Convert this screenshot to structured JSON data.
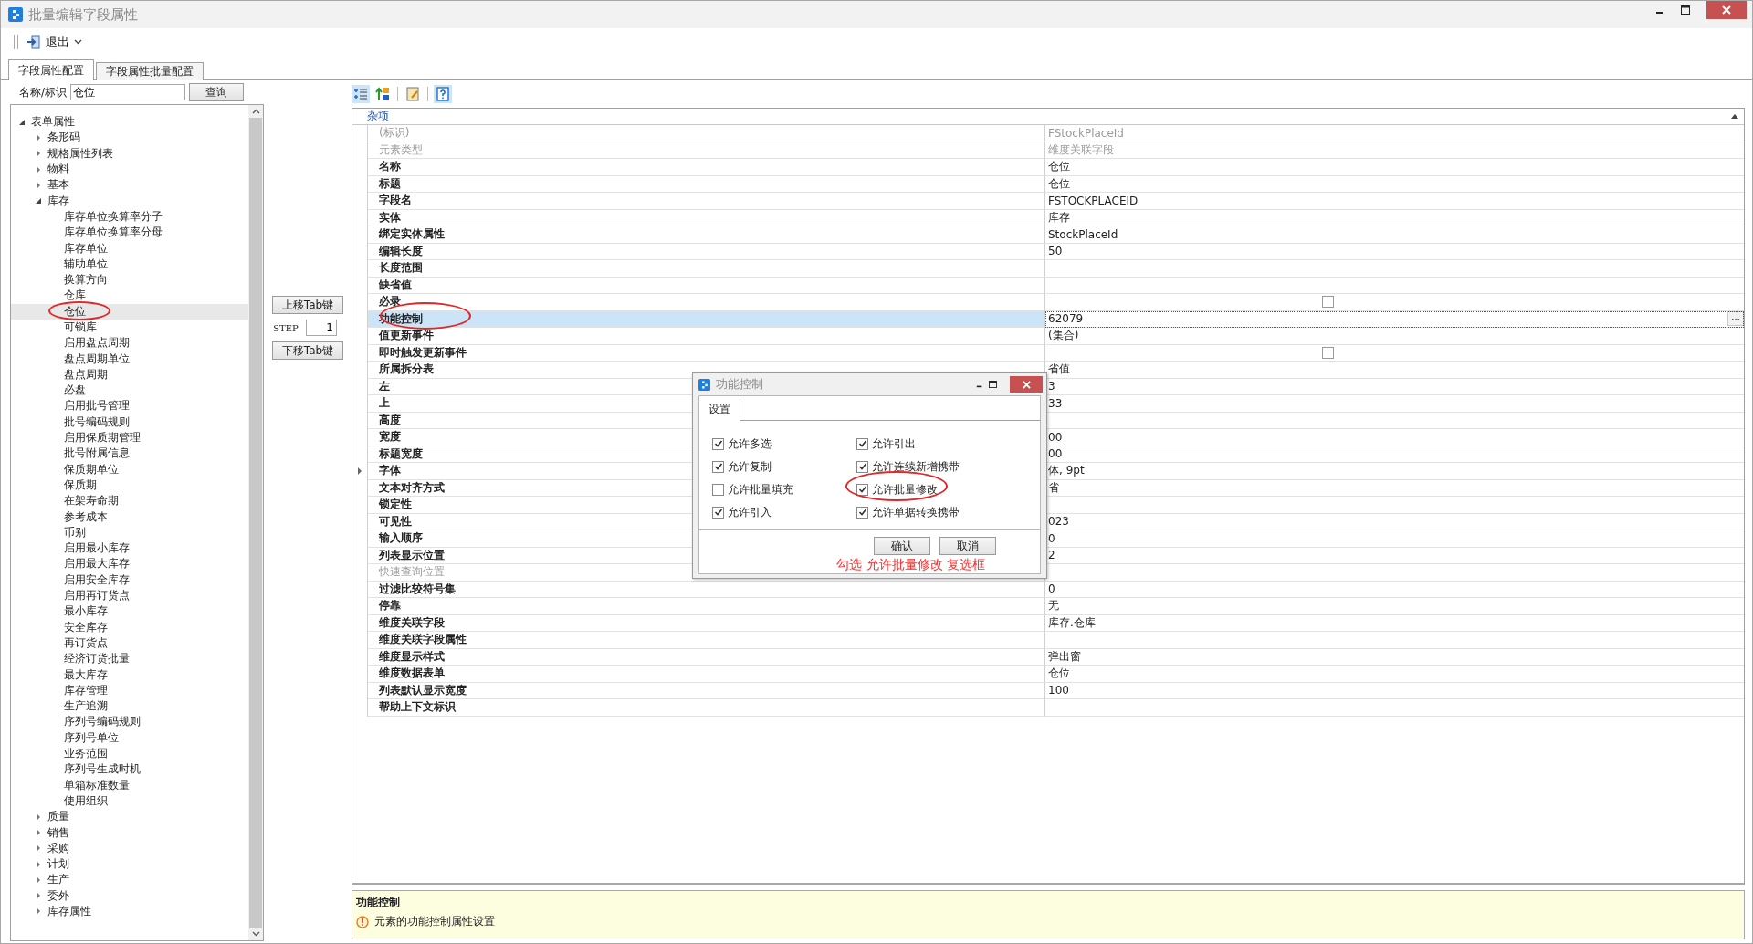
{
  "window": {
    "title": "批量编辑字段属性"
  },
  "toolbar": {
    "items": [
      {
        "label": "退出"
      }
    ]
  },
  "tabs": [
    {
      "label": "字段属性配置",
      "selected": true
    },
    {
      "label": "字段属性批量配置",
      "selected": false
    }
  ],
  "search": {
    "label": "名称/标识",
    "value": "仓位",
    "button": "查询"
  },
  "tree": {
    "items": [
      {
        "label": "表单属性",
        "expanded": true,
        "selected": false,
        "children": [
          {
            "label": "条形码",
            "expanded": false,
            "selected": false
          },
          {
            "label": "规格属性列表",
            "expanded": false,
            "selected": false
          },
          {
            "label": "物料",
            "expanded": false,
            "selected": false
          },
          {
            "label": "基本",
            "expanded": false,
            "selected": false
          },
          {
            "label": "库存",
            "expanded": true,
            "selected": false,
            "children": [
              {
                "label": "库存单位换算率分子",
                "selected": false
              },
              {
                "label": "库存单位换算率分母",
                "selected": false
              },
              {
                "label": "库存单位",
                "selected": false
              },
              {
                "label": "辅助单位",
                "selected": false
              },
              {
                "label": "换算方向",
                "selected": false
              },
              {
                "label": "仓库",
                "selected": false
              },
              {
                "label": "仓位",
                "selected": true
              },
              {
                "label": "可锁库",
                "selected": false
              },
              {
                "label": "启用盘点周期",
                "selected": false
              },
              {
                "label": "盘点周期单位",
                "selected": false
              },
              {
                "label": "盘点周期",
                "selected": false
              },
              {
                "label": "必盘",
                "selected": false
              },
              {
                "label": "启用批号管理",
                "selected": false
              },
              {
                "label": "批号编码规则",
                "selected": false
              },
              {
                "label": "启用保质期管理",
                "selected": false
              },
              {
                "label": "批号附属信息",
                "selected": false
              },
              {
                "label": "保质期单位",
                "selected": false
              },
              {
                "label": "保质期",
                "selected": false
              },
              {
                "label": "在架寿命期",
                "selected": false
              },
              {
                "label": "参考成本",
                "selected": false
              },
              {
                "label": "币别",
                "selected": false
              },
              {
                "label": "启用最小库存",
                "selected": false
              },
              {
                "label": "启用最大库存",
                "selected": false
              },
              {
                "label": "启用安全库存",
                "selected": false
              },
              {
                "label": "启用再订货点",
                "selected": false
              },
              {
                "label": "最小库存",
                "selected": false
              },
              {
                "label": "安全库存",
                "selected": false
              },
              {
                "label": "再订货点",
                "selected": false
              },
              {
                "label": "经济订货批量",
                "selected": false
              },
              {
                "label": "最大库存",
                "selected": false
              },
              {
                "label": "库存管理",
                "selected": false
              },
              {
                "label": "生产追溯",
                "selected": false
              },
              {
                "label": "序列号编码规则",
                "selected": false
              },
              {
                "label": "序列号单位",
                "selected": false
              },
              {
                "label": "业务范围",
                "selected": false
              },
              {
                "label": "序列号生成时机",
                "selected": false
              },
              {
                "label": "单箱标准数量",
                "selected": false
              },
              {
                "label": "使用组织",
                "selected": false
              }
            ]
          },
          {
            "label": "质量",
            "expanded": false,
            "selected": false
          },
          {
            "label": "销售",
            "expanded": false,
            "selected": false
          },
          {
            "label": "采购",
            "expanded": false,
            "selected": false
          },
          {
            "label": "计划",
            "expanded": false,
            "selected": false
          },
          {
            "label": "生产",
            "expanded": false,
            "selected": false
          },
          {
            "label": "委外",
            "expanded": false,
            "selected": false
          },
          {
            "label": "库存属性",
            "expanded": false,
            "selected": false
          }
        ]
      }
    ]
  },
  "tab_order": {
    "up_button": "上移Tab键",
    "step_label": "STEP",
    "step_value": "1",
    "down_button": "下移Tab键"
  },
  "grid_toolbar": [
    {
      "kind": "categorized",
      "selected": true
    },
    {
      "kind": "alphabetical",
      "selected": false
    },
    {
      "kind": "pages",
      "selected": false
    },
    {
      "kind": "help",
      "selected": true
    }
  ],
  "grid": {
    "category": "杂项",
    "expanded": true,
    "rows": [
      {
        "name": "(标识)",
        "kind": "text",
        "value": "FStockPlaceId",
        "disabled": true,
        "selected": false
      },
      {
        "name": "元素类型",
        "kind": "text",
        "value": "维度关联字段",
        "disabled": true,
        "selected": false
      },
      {
        "name": "名称",
        "kind": "text",
        "value": "仓位",
        "disabled": false,
        "selected": false
      },
      {
        "name": "标题",
        "kind": "text",
        "value": "仓位",
        "disabled": false,
        "selected": false
      },
      {
        "name": "字段名",
        "kind": "text",
        "value": "FSTOCKPLACEID",
        "disabled": false,
        "selected": false
      },
      {
        "name": "实体",
        "kind": "text",
        "value": "库存",
        "disabled": false,
        "selected": false
      },
      {
        "name": "绑定实体属性",
        "kind": "text",
        "value": "StockPlaceId",
        "disabled": false,
        "selected": false
      },
      {
        "name": "编辑长度",
        "kind": "text",
        "value": "50",
        "disabled": false,
        "selected": false
      },
      {
        "name": "长度范围",
        "kind": "text",
        "disabled": false,
        "selected": false
      },
      {
        "name": "缺省值",
        "kind": "text",
        "disabled": false,
        "selected": false
      },
      {
        "name": "必录",
        "kind": "checkbox",
        "checked": false,
        "disabled": false,
        "selected": false
      },
      {
        "name": "功能控制",
        "kind": "text",
        "value": "62079",
        "button": "···",
        "disabled": false,
        "selected": true
      },
      {
        "name": "值更新事件",
        "kind": "text",
        "value": "(集合)",
        "disabled": false,
        "selected": false
      },
      {
        "name": "即时触发更新事件",
        "kind": "checkbox",
        "checked": false,
        "disabled": false,
        "selected": false
      },
      {
        "name": "所属拆分表",
        "kind": "text",
        "value": "省值",
        "disabled": false,
        "selected": false
      },
      {
        "name": "左",
        "kind": "text",
        "value": "3",
        "disabled": false,
        "selected": false
      },
      {
        "name": "上",
        "kind": "text",
        "value": "33",
        "disabled": false,
        "selected": false
      },
      {
        "name": "高度",
        "kind": "text",
        "disabled": false,
        "selected": false
      },
      {
        "name": "宽度",
        "kind": "text",
        "value": "00",
        "disabled": false,
        "selected": false
      },
      {
        "name": "标题宽度",
        "kind": "text",
        "value": "00",
        "disabled": false,
        "selected": false
      },
      {
        "name": "字体",
        "kind": "text",
        "value": "体, 9pt",
        "expanded": false,
        "disabled": false,
        "selected": false
      },
      {
        "name": "文本对齐方式",
        "kind": "text",
        "value": "省",
        "disabled": false,
        "selected": false
      },
      {
        "name": "锁定性",
        "kind": "text",
        "disabled": false,
        "selected": false
      },
      {
        "name": "可见性",
        "kind": "text",
        "value": "023",
        "disabled": false,
        "selected": false
      },
      {
        "name": "输入顺序",
        "kind": "text",
        "value": "0",
        "disabled": false,
        "selected": false
      },
      {
        "name": "列表显示位置",
        "kind": "text",
        "value": "2",
        "disabled": false,
        "selected": false
      },
      {
        "name": "快速查询位置",
        "kind": "text",
        "disabled": true,
        "selected": false
      },
      {
        "name": "过滤比较符号集",
        "kind": "text",
        "value": "0",
        "disabled": false,
        "selected": false
      },
      {
        "name": "停靠",
        "kind": "text",
        "value": "无",
        "disabled": false,
        "selected": false
      },
      {
        "name": "维度关联字段",
        "kind": "text",
        "value": "库存.仓库",
        "disabled": false,
        "selected": false
      },
      {
        "name": "维度关联字段属性",
        "kind": "text",
        "disabled": false,
        "selected": false
      },
      {
        "name": "维度显示样式",
        "kind": "text",
        "value": "弹出窗",
        "disabled": false,
        "selected": false
      },
      {
        "name": "维度数据表单",
        "kind": "text",
        "value": "仓位",
        "disabled": false,
        "selected": false
      },
      {
        "name": "列表默认显示宽度",
        "kind": "text",
        "value": "100",
        "disabled": false,
        "selected": false
      },
      {
        "name": "帮助上下文标识",
        "kind": "text",
        "disabled": false,
        "selected": false
      }
    ]
  },
  "help": {
    "title": "功能控制",
    "description": "元素的功能控制属性设置"
  },
  "dialog": {
    "title": "功能控制",
    "tabs": [
      {
        "label": "设置",
        "selected": true
      }
    ],
    "options": [
      {
        "label": "允许多选",
        "checked": true
      },
      {
        "label": "允许复制",
        "checked": true
      },
      {
        "label": "允许批量填充",
        "checked": false
      },
      {
        "label": "允许引入",
        "checked": true
      },
      {
        "label": "允许引出",
        "checked": true
      },
      {
        "label": "允许连续新增携带",
        "checked": true
      },
      {
        "label": "允许批量修改",
        "checked": true
      },
      {
        "label": "允许单据转换携带",
        "checked": true
      }
    ],
    "buttons": [
      "确认",
      "取消"
    ],
    "annotation": "勾选 允许批量修改 复选框"
  }
}
